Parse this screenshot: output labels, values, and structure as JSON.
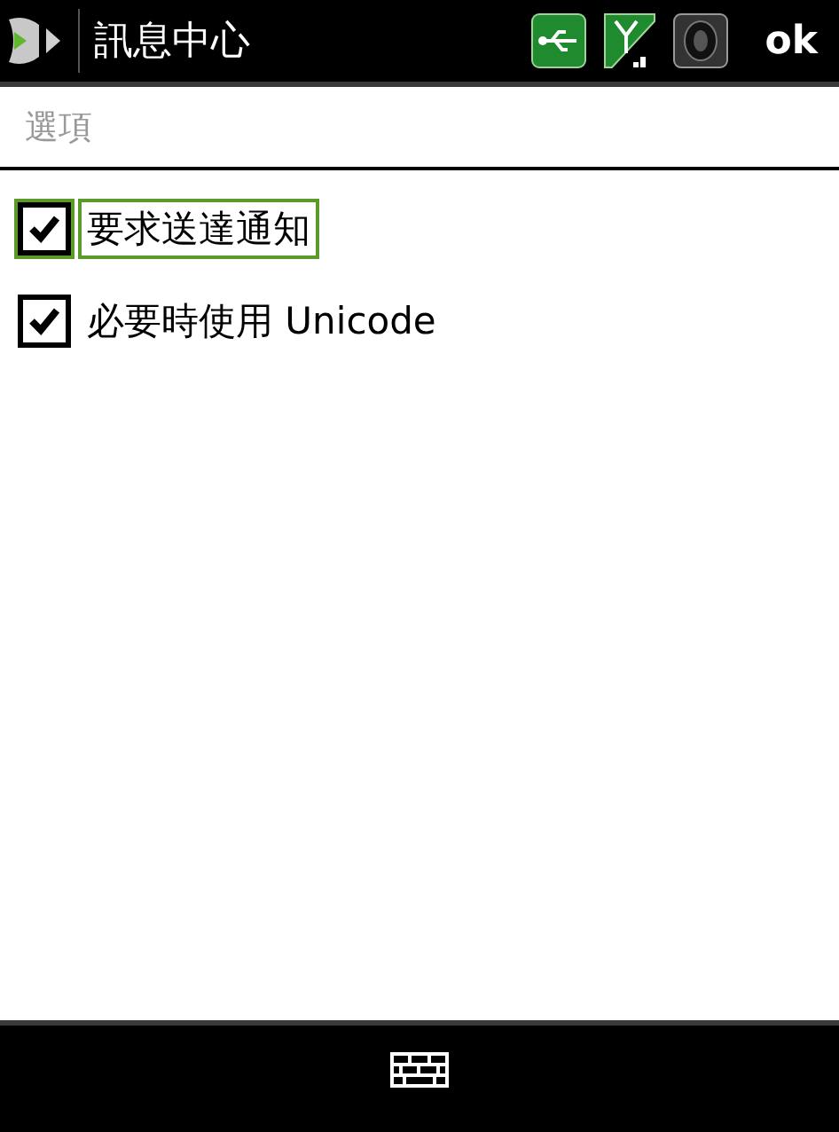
{
  "title_bar": {
    "title": "訊息中心",
    "action": "ok"
  },
  "section": {
    "title": "選項"
  },
  "options": [
    {
      "label": "要求送達通知",
      "checked": true,
      "focused": true
    },
    {
      "label": "必要時使用 Unicode",
      "checked": true,
      "focused": false
    }
  ]
}
